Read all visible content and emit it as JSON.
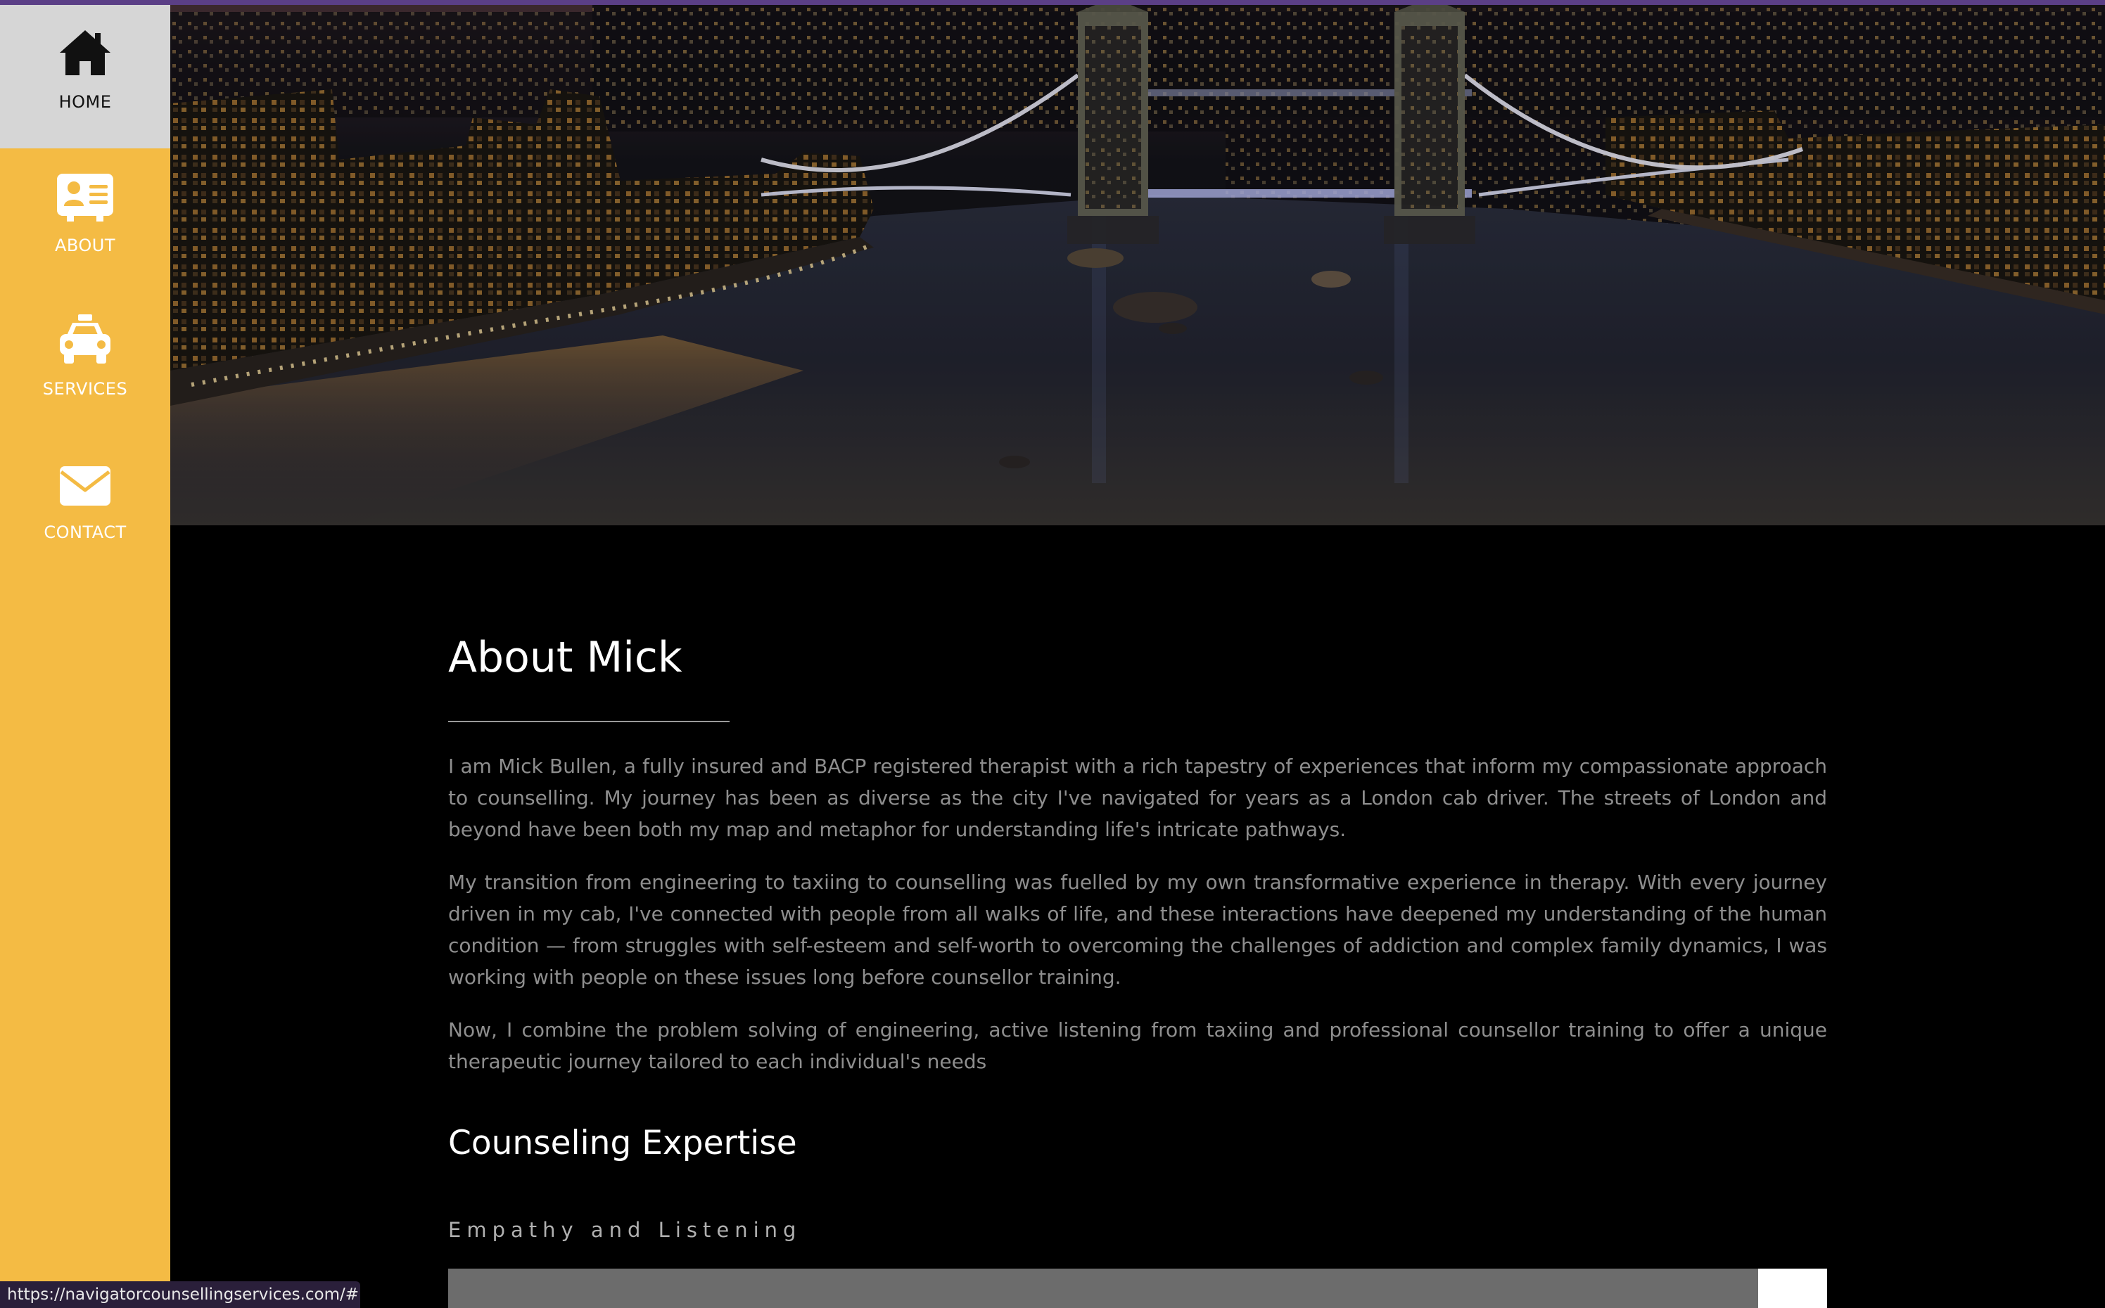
{
  "nav": {
    "items": [
      {
        "label": "HOME",
        "icon": "home-icon"
      },
      {
        "label": "ABOUT",
        "icon": "id-card-icon"
      },
      {
        "label": "SERVICES",
        "icon": "taxi-icon"
      },
      {
        "label": "CONTACT",
        "icon": "envelope-icon"
      }
    ],
    "active": "HOME"
  },
  "hero": {
    "image": "night view of Tower Bridge over the River Thames, London"
  },
  "about": {
    "title": "About Mick",
    "paragraphs": [
      "I am Mick Bullen, a fully insured and BACP registered therapist with a rich tapestry of experiences that inform my compassionate approach to counselling. My journey has been as diverse as the city I've navigated for years as a London cab driver. The streets of London and beyond have been both my map and metaphor for understanding life's intricate pathways.",
      "My transition from engineering to taxiing to counselling was fuelled by my own transformative experience in therapy. With every journey driven in my cab, I've connected with people from all walks of life, and these interactions have deepened my understanding of the human condition — from struggles with self-esteem and self-worth to overcoming the challenges of addiction and complex family dynamics, I was working with people on these issues long before counsellor training.",
      "Now, I combine the problem solving of engineering, active listening from taxiing and professional counsellor training to offer a unique therapeutic journey tailored to each individual's needs"
    ]
  },
  "expertise": {
    "title": "Counseling Expertise",
    "skills": [
      {
        "label": "Empathy and Listening",
        "level": 0.95
      }
    ]
  },
  "status_bar": {
    "url": "https://navigatorcounsellingservices.com/#"
  },
  "colors": {
    "sidebar": "#f4bb44",
    "active_nav": "#d6d6d6",
    "background": "#000000",
    "top_strip": "#5b3f86",
    "progress_fill": "#6c6c6c"
  }
}
